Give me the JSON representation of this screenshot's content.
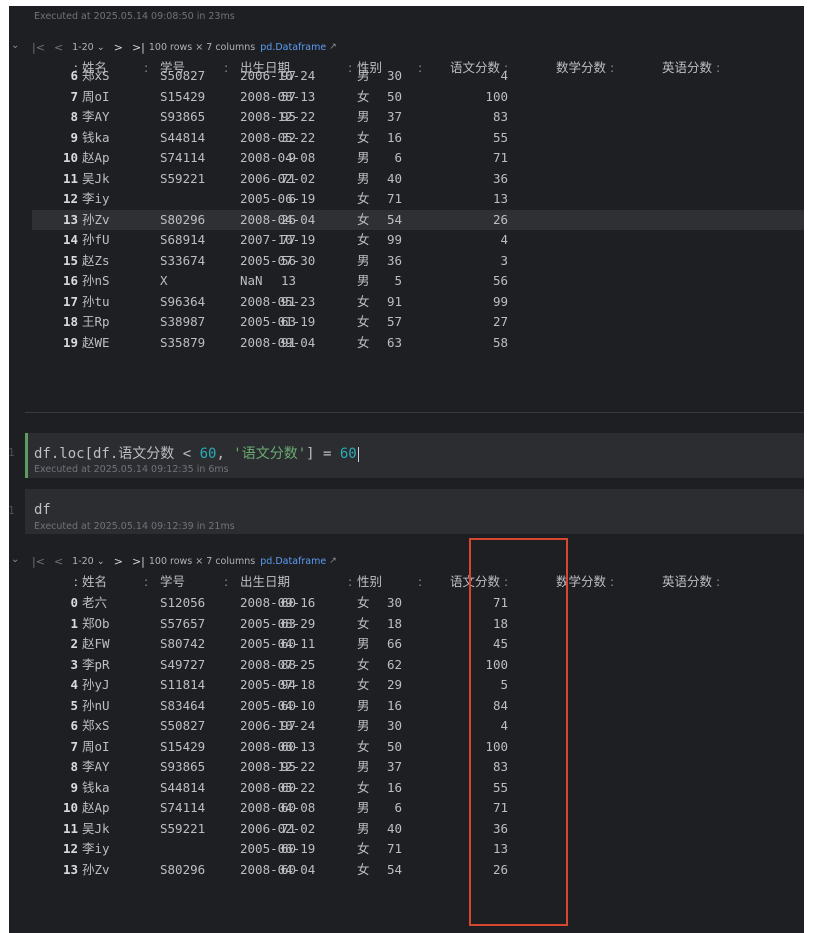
{
  "cell_top": {
    "exec_info": "Executed at 2025.05.14 09:08:50 in 23ms",
    "toolbar": {
      "first": "|<",
      "prev": "<",
      "range": "1-20",
      "range_arrow": "⌄",
      "next": ">",
      "last": ">|",
      "shape": "100 rows × 7 columns",
      "link": "pd.Dataframe",
      "link_icon": "↗"
    },
    "headers": {
      "index": ":",
      "name": "姓名",
      "id": "学号",
      "dob": "出生日期",
      "sex": "性别",
      "chinese": "语文分数",
      "math": "数学分数",
      "english": "英语分数",
      "sort": ":"
    },
    "rows": [
      {
        "i": "6",
        "name": "郑xS",
        "id": "S50827",
        "dob": "2006-10-24",
        "sex": "男",
        "chn": "97",
        "math": "30",
        "eng": "4"
      },
      {
        "i": "7",
        "name": "周oI",
        "id": "S15429",
        "dob": "2008-08-13",
        "sex": "女",
        "chn": "57",
        "math": "50",
        "eng": "100"
      },
      {
        "i": "8",
        "name": "李AY",
        "id": "S93865",
        "dob": "2008-12-22",
        "sex": "男",
        "chn": "95",
        "math": "37",
        "eng": "83"
      },
      {
        "i": "9",
        "name": "钱ka",
        "id": "S44814",
        "dob": "2008-05-22",
        "sex": "女",
        "chn": "32",
        "math": "16",
        "eng": "55"
      },
      {
        "i": "10",
        "name": "赵Ap",
        "id": "S74114",
        "dob": "2008-04-08",
        "sex": "男",
        "chn": "9",
        "math": "6",
        "eng": "71"
      },
      {
        "i": "11",
        "name": "吴Jk",
        "id": "S59221",
        "dob": "2006-02-02",
        "sex": "男",
        "chn": "71",
        "math": "40",
        "eng": "36"
      },
      {
        "i": "12",
        "name": "李iy",
        "id": "",
        "dob": "2005-06-19",
        "sex": "女",
        "chn": "6",
        "math": "71",
        "eng": "13"
      },
      {
        "i": "13",
        "name": "孙Zv",
        "id": "S80296",
        "dob": "2008-04-04",
        "sex": "女",
        "chn": "26",
        "math": "54",
        "eng": "26"
      },
      {
        "i": "14",
        "name": "孙fU",
        "id": "S68914",
        "dob": "2007-10-19",
        "sex": "女",
        "chn": "77",
        "math": "99",
        "eng": "4"
      },
      {
        "i": "15",
        "name": "赵Zs",
        "id": "S33674",
        "dob": "2005-07-30",
        "sex": "男",
        "chn": "56",
        "math": "36",
        "eng": "3"
      },
      {
        "i": "16",
        "name": "孙nS",
        "id": "X",
        "dob": "NaN",
        "sex": "男",
        "chn": "13",
        "math": "5",
        "eng": "56"
      },
      {
        "i": "17",
        "name": "孙tu",
        "id": "S96364",
        "dob": "2008-05-23",
        "sex": "女",
        "chn": "91",
        "math": "91",
        "eng": "99"
      },
      {
        "i": "18",
        "name": "王Rp",
        "id": "S38987",
        "dob": "2005-01-19",
        "sex": "女",
        "chn": "63",
        "math": "57",
        "eng": "27"
      },
      {
        "i": "19",
        "name": "赵WE",
        "id": "S35879",
        "dob": "2008-09-04",
        "sex": "女",
        "chn": "91",
        "math": "63",
        "eng": "58"
      }
    ]
  },
  "cell_assign": {
    "line_number": "1",
    "code_pre": "df.loc[df.语文分数 < ",
    "code_num1": "60",
    "code_mid": ", ",
    "code_str": "'语文分数'",
    "code_post": "] = ",
    "code_num2": "60",
    "exec_info": "Executed at 2025.05.14 09:12:35 in 6ms"
  },
  "cell_df": {
    "line_number": "1",
    "code": "df",
    "exec_info": "Executed at 2025.05.14 09:12:39 in 21ms",
    "toolbar": {
      "first": "|<",
      "prev": "<",
      "range": "1-20",
      "range_arrow": "⌄",
      "next": ">",
      "last": ">|",
      "shape": "100 rows × 7 columns",
      "link": "pd.Dataframe",
      "link_icon": "↗"
    },
    "rows": [
      {
        "i": "0",
        "name": "老六",
        "id": "S12056",
        "dob": "2008-09-16",
        "sex": "女",
        "chn": "60",
        "math": "30",
        "eng": "71"
      },
      {
        "i": "1",
        "name": "郑Ob",
        "id": "S57657",
        "dob": "2005-08-29",
        "sex": "女",
        "chn": "63",
        "math": "18",
        "eng": "18"
      },
      {
        "i": "2",
        "name": "赵FW",
        "id": "S80742",
        "dob": "2005-04-11",
        "sex": "男",
        "chn": "60",
        "math": "66",
        "eng": "45"
      },
      {
        "i": "3",
        "name": "李pR",
        "id": "S49727",
        "dob": "2008-07-25",
        "sex": "女",
        "chn": "88",
        "math": "62",
        "eng": "100"
      },
      {
        "i": "4",
        "name": "孙yJ",
        "id": "S11814",
        "dob": "2005-07-18",
        "sex": "女",
        "chn": "94",
        "math": "29",
        "eng": "5"
      },
      {
        "i": "5",
        "name": "孙nU",
        "id": "S83464",
        "dob": "2005-04-10",
        "sex": "男",
        "chn": "60",
        "math": "16",
        "eng": "84"
      },
      {
        "i": "6",
        "name": "郑xS",
        "id": "S50827",
        "dob": "2006-10-24",
        "sex": "男",
        "chn": "97",
        "math": "30",
        "eng": "4"
      },
      {
        "i": "7",
        "name": "周oI",
        "id": "S15429",
        "dob": "2008-08-13",
        "sex": "女",
        "chn": "60",
        "math": "50",
        "eng": "100"
      },
      {
        "i": "8",
        "name": "李AY",
        "id": "S93865",
        "dob": "2008-12-22",
        "sex": "男",
        "chn": "95",
        "math": "37",
        "eng": "83"
      },
      {
        "i": "9",
        "name": "钱ka",
        "id": "S44814",
        "dob": "2008-05-22",
        "sex": "女",
        "chn": "60",
        "math": "16",
        "eng": "55"
      },
      {
        "i": "10",
        "name": "赵Ap",
        "id": "S74114",
        "dob": "2008-04-08",
        "sex": "男",
        "chn": "60",
        "math": "6",
        "eng": "71"
      },
      {
        "i": "11",
        "name": "吴Jk",
        "id": "S59221",
        "dob": "2006-02-02",
        "sex": "男",
        "chn": "71",
        "math": "40",
        "eng": "36"
      },
      {
        "i": "12",
        "name": "李iy",
        "id": "",
        "dob": "2005-06-19",
        "sex": "女",
        "chn": "60",
        "math": "71",
        "eng": "13"
      },
      {
        "i": "13",
        "name": "孙Zv",
        "id": "S80296",
        "dob": "2008-04-04",
        "sex": "女",
        "chn": "60",
        "math": "54",
        "eng": "26"
      }
    ]
  },
  "colors": {
    "panel_bg": "#1e1f22",
    "highlight_box": "#d9462f",
    "link": "#5c9cf5"
  }
}
